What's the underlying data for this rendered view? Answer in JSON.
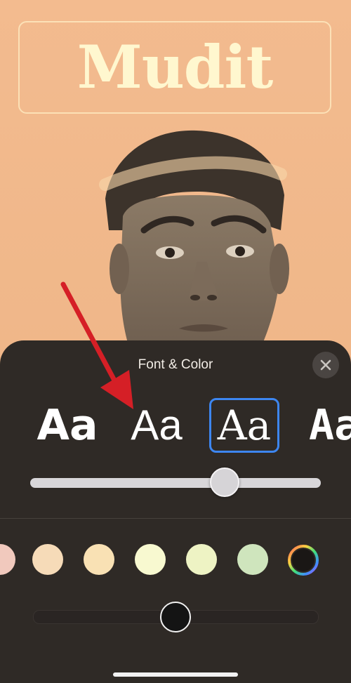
{
  "poster": {
    "name": "Mudit"
  },
  "sheet": {
    "title": "Font & Color"
  },
  "fonts": [
    {
      "label": "Aa",
      "style": "sans-bold",
      "selected": false
    },
    {
      "label": "Aa",
      "style": "sans-rounded",
      "selected": false
    },
    {
      "label": "Aa",
      "style": "serif",
      "selected": true
    },
    {
      "label": "Aa",
      "style": "condensed",
      "selected": false
    }
  ],
  "font_weight_slider": {
    "value_fraction": 0.67
  },
  "colors": [
    {
      "name": "pink",
      "hex": "#f1c9bd"
    },
    {
      "name": "peach",
      "hex": "#f6dbb8"
    },
    {
      "name": "light-orange",
      "hex": "#f9e1b4"
    },
    {
      "name": "cream",
      "hex": "#f8f9d0"
    },
    {
      "name": "pale-yellow-green",
      "hex": "#eef3c4"
    },
    {
      "name": "light-green",
      "hex": "#cfe5bd"
    }
  ],
  "accent_color": "#3d86f0",
  "color_slider": {
    "value_fraction": 0.5
  },
  "icons": [
    "close-icon",
    "color-wheel-icon"
  ],
  "annotation": {
    "arrow_color": "#d51f26"
  }
}
